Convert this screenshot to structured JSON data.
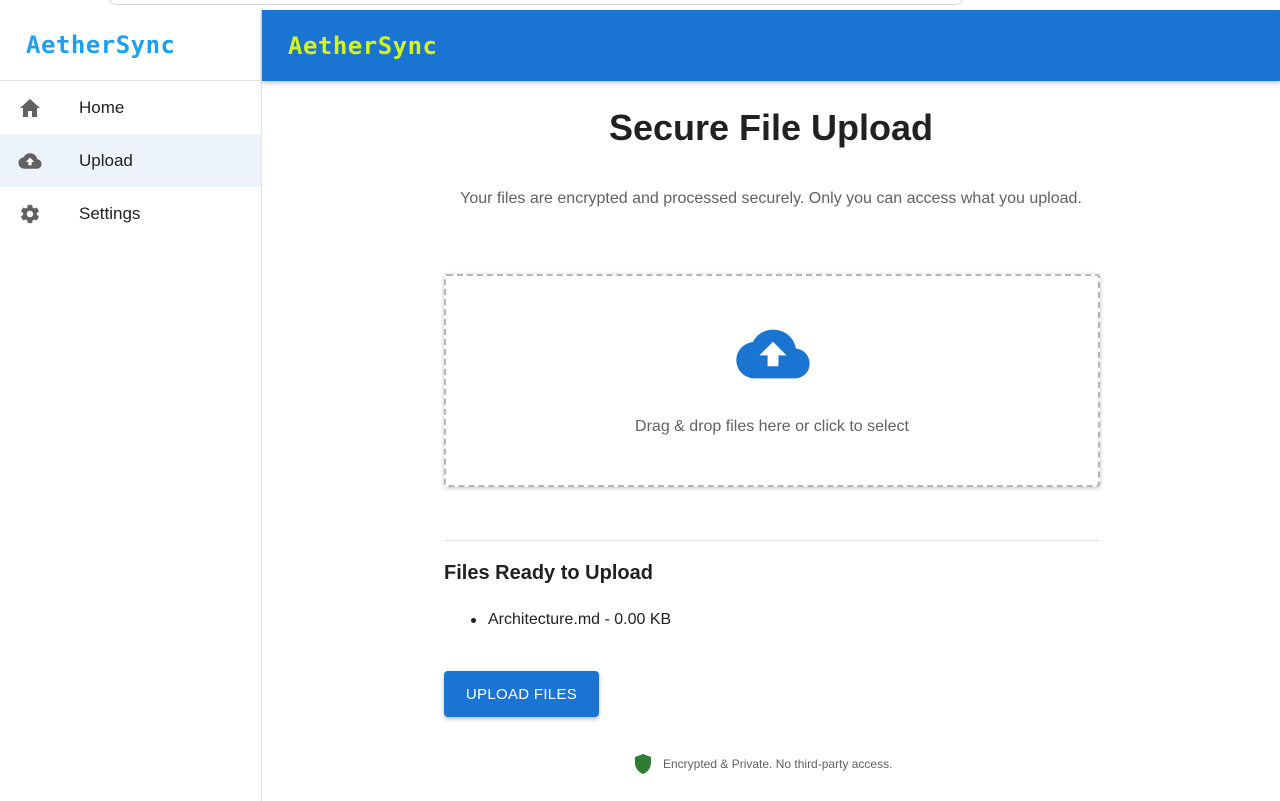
{
  "app": {
    "name": "AetherSync",
    "brand_color_sidebar": "#1ea0f0",
    "brand_color_topbar": "#d2f51e",
    "topbar_color": "#1a75d2"
  },
  "sidebar": {
    "items": [
      {
        "label": "Home",
        "icon": "home-icon",
        "active": false
      },
      {
        "label": "Upload",
        "icon": "cloud-upload-icon",
        "active": true
      },
      {
        "label": "Settings",
        "icon": "gear-icon",
        "active": false
      }
    ]
  },
  "main": {
    "title": "Secure File Upload",
    "subtitle": "Your files are encrypted and processed securely. Only you can access what you upload.",
    "dropzone": {
      "icon": "cloud-upload-icon",
      "text": "Drag & drop files here or click to select"
    },
    "files_section": {
      "title": "Files Ready to Upload",
      "files": [
        "Architecture.md - 0.00 KB"
      ]
    },
    "upload_button": "UPLOAD FILES",
    "footer": {
      "icon": "shield-icon",
      "text": "Encrypted & Private. No third-party access.",
      "icon_color": "#2e7d32"
    }
  }
}
